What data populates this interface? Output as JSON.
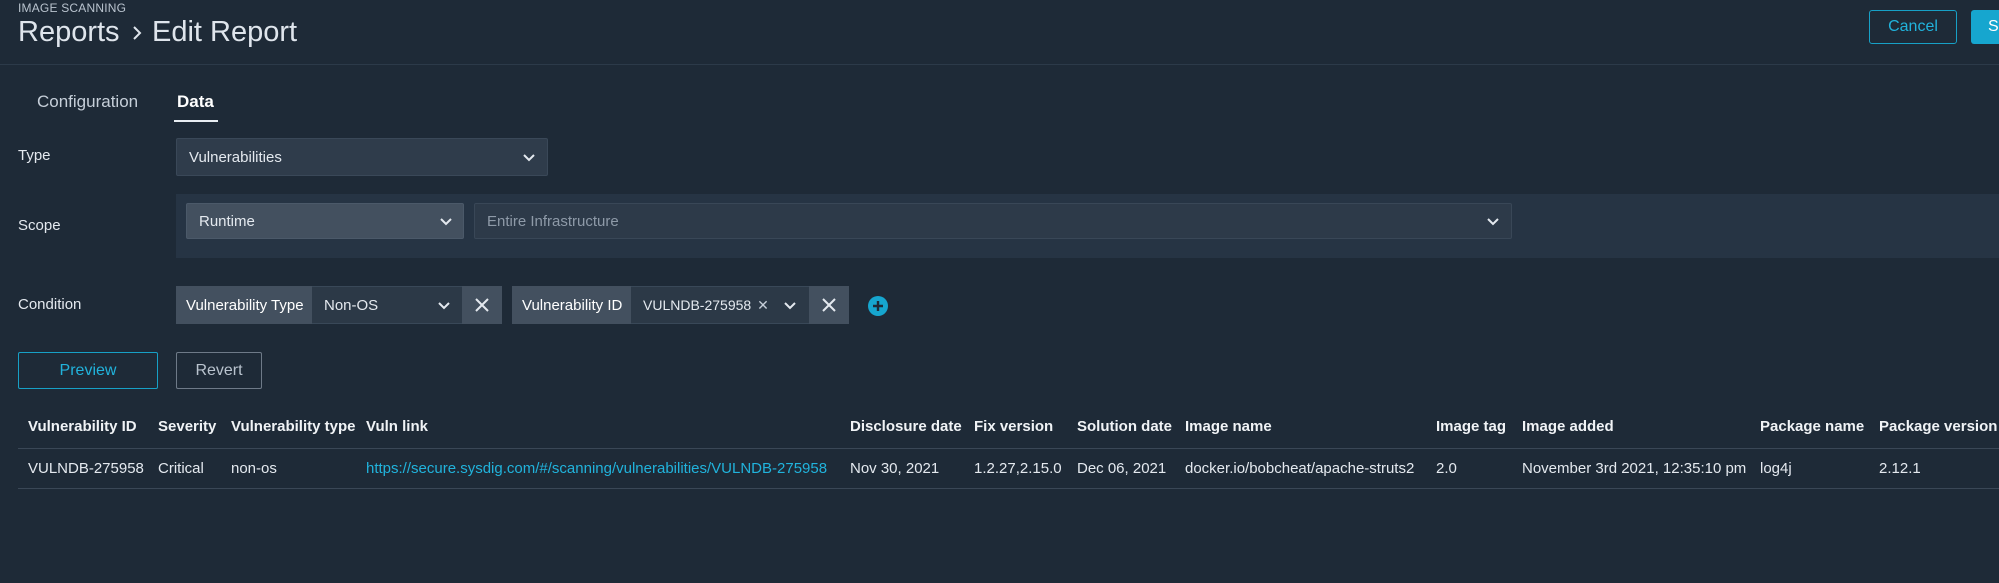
{
  "header": {
    "eyebrow": "IMAGE SCANNING",
    "breadcrumb_parent": "Reports",
    "breadcrumb_current": "Edit Report",
    "cancel_label": "Cancel",
    "save_label": "Sa"
  },
  "tabs": [
    {
      "label": "Configuration",
      "active": false
    },
    {
      "label": "Data",
      "active": true
    }
  ],
  "form": {
    "type_label": "Type",
    "type_value": "Vulnerabilities",
    "scope_label": "Scope",
    "scope_value": "Runtime",
    "scope_placeholder": "Entire Infrastructure",
    "condition_label": "Condition",
    "conditions": [
      {
        "key": "Vulnerability Type",
        "value": "Non-OS"
      },
      {
        "key": "Vulnerability ID",
        "value": "VULNDB-275958"
      }
    ]
  },
  "actions": {
    "preview_label": "Preview",
    "revert_label": "Revert"
  },
  "table": {
    "columns": [
      "Vulnerability ID",
      "Severity",
      "Vulnerability type",
      "Vuln link",
      "Disclosure date",
      "Fix version",
      "Solution date",
      "Image name",
      "Image tag",
      "Image added",
      "Package name",
      "Package version"
    ],
    "rows": [
      [
        "VULNDB-275958",
        "Critical",
        "non-os",
        "https://secure.sysdig.com/#/scanning/vulnerabilities/VULNDB-275958",
        "Nov 30, 2021",
        "1.2.27,2.15.0",
        "Dec 06, 2021",
        "docker.io/bobcheat/apache-struts2",
        "2.0",
        "November 3rd 2021, 12:35:10 pm",
        "log4j",
        "2.12.1"
      ]
    ]
  },
  "colors": {
    "background": "#1e2a37",
    "accent": "#16a6cf",
    "link": "#21b3dc"
  }
}
